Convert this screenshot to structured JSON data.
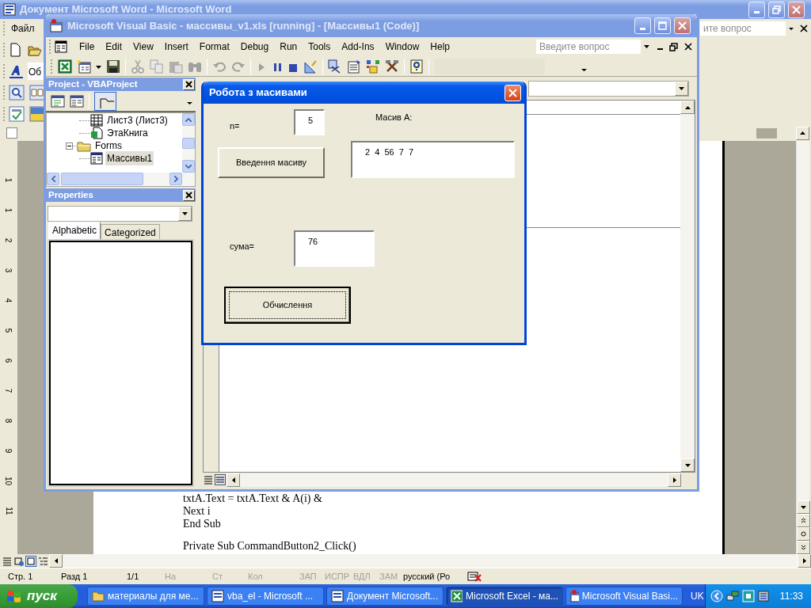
{
  "word_window": {
    "title": "Документ Microsoft Word - Microsoft Word",
    "menu": [
      {
        "label": "Файл"
      }
    ],
    "ask_field": {
      "placeholder": "ите вопрос"
    },
    "style_field": {
      "value": "Об"
    },
    "vertical_ruler": [
      "1",
      "1",
      "2",
      "3",
      "4",
      "5",
      "6",
      "7",
      "8",
      "9",
      "10",
      "11"
    ],
    "document_paragraphs": [
      {
        "lines": [
          "txtA.Text = txtA.Text & A(i) &",
          "Next i",
          "End Sub"
        ]
      },
      {
        "lines": [
          "Private Sub CommandButton2_Click()"
        ]
      }
    ],
    "status_bar": [
      {
        "text": "Стр. 1",
        "disabled": false
      },
      {
        "text": "Разд 1",
        "disabled": false
      },
      {
        "text": "1/1",
        "disabled": false
      },
      {
        "text": "На",
        "disabled": true
      },
      {
        "text": "Ст",
        "disabled": true
      },
      {
        "text": "Кол",
        "disabled": true
      },
      {
        "text": "ЗАП",
        "disabled": true
      },
      {
        "text": "ИСПР",
        "disabled": true
      },
      {
        "text": "ВДЛ",
        "disabled": true
      },
      {
        "text": "ЗАМ",
        "disabled": true
      },
      {
        "text": "русский (Ро",
        "disabled": false
      }
    ]
  },
  "vba_window": {
    "title": "Microsoft Visual Basic - массивы_v1.xls [running] - [Массивы1 (Code)]",
    "menu": [
      "File",
      "Edit",
      "View",
      "Insert",
      "Format",
      "Debug",
      "Run",
      "Tools",
      "Add-Ins",
      "Window",
      "Help"
    ],
    "ask_field": {
      "placeholder": "Введите вопрос"
    },
    "project_panel": {
      "title": "Project - VBAProject",
      "tree": [
        {
          "kind": "partial",
          "children": [
            {
              "kind": "sheet",
              "label": "Лист3 (Лист3)",
              "selected": false
            },
            {
              "kind": "workbook",
              "label": "ЭтаКнига",
              "selected": false
            }
          ]
        },
        {
          "kind": "folder",
          "label": "Forms",
          "expanded": true,
          "selected": false,
          "children": [
            {
              "kind": "form",
              "label": "Массивы1",
              "selected": true
            }
          ]
        }
      ]
    },
    "properties_panel": {
      "title": "Properties",
      "tabs": [
        {
          "label": "Alphabetic",
          "selected": true
        },
        {
          "label": "Categorized",
          "selected": false
        }
      ]
    }
  },
  "userform": {
    "title": "Робота з масивами",
    "controls": [
      {
        "kind": "label",
        "text": "n="
      },
      {
        "kind": "textbox",
        "value": "5"
      },
      {
        "kind": "label",
        "text": "Масив А:"
      },
      {
        "kind": "button",
        "label": "Введення масиву",
        "focused": false
      },
      {
        "kind": "textbox",
        "value": "2  4  56  7  7"
      },
      {
        "kind": "label",
        "text": "сума="
      },
      {
        "kind": "textbox",
        "value": "76"
      },
      {
        "kind": "button",
        "label": "Обчислення",
        "focused": true
      }
    ]
  },
  "taskbar": {
    "start_label": "пуск",
    "tasks": [
      {
        "kind": "folder",
        "label": "материалы для ме...",
        "selected": false
      },
      {
        "kind": "word",
        "label": "vba_el - Microsoft ...",
        "selected": false
      },
      {
        "kind": "word",
        "label": "Документ Microsoft...",
        "selected": false
      },
      {
        "kind": "excel",
        "label": "Microsoft Excel - ма...",
        "selected": true
      },
      {
        "kind": "vba",
        "label": "Microsoft Visual Basi...",
        "selected": false
      }
    ],
    "language": "UK",
    "clock": "11:33"
  }
}
